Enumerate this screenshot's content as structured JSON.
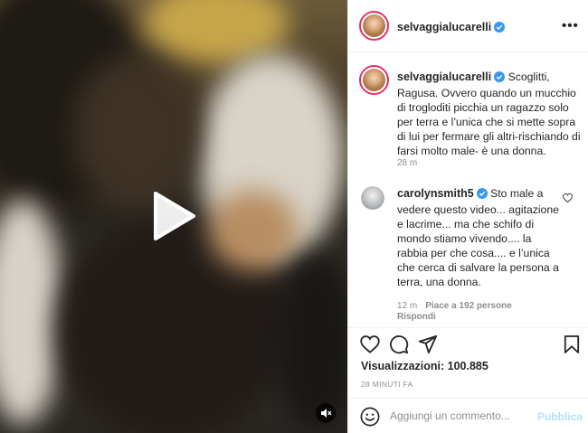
{
  "post": {
    "username": "selvaggialucarelli",
    "caption": "Scoglitti, Ragusa. Ovvero quando un mucchio di trogloditi picchia un ragazzo solo per terra e l’unica che si mette sopra di lui per fermare gli altri-rischiando di farsi molto male- è una donna.",
    "caption_time": "28 m"
  },
  "comment": {
    "username": "carolynsmith5",
    "text": "Sto male a vedere questo video... agitazione e lacrime... ma che schifo di mondo stiamo vivendo.... la rabbia per che cosa.... e l’unica che cerca di salvare la persona a terra, una donna.",
    "time": "12 m",
    "likes": "Piace a 192 persone",
    "reply_label": "Rispondi"
  },
  "stats": {
    "views_label": "Visualizzazioni:",
    "views_count": "100.885",
    "posted_ago": "28 MINUTI FA"
  },
  "composer": {
    "placeholder": "Aggiungi un commento...",
    "publish_label": "Pubblica"
  },
  "icons": {
    "more": "more-options-icon",
    "play": "play-icon",
    "mute": "mute-icon",
    "like": "heart-icon",
    "comment": "comment-icon",
    "share": "share-icon",
    "save": "bookmark-icon",
    "emoji": "emoji-icon",
    "verified": "verified-badge-icon"
  },
  "colors": {
    "verified": "#3897f0",
    "publish_disabled": "#b2dffc",
    "muted_text": "#8e8e8e"
  }
}
